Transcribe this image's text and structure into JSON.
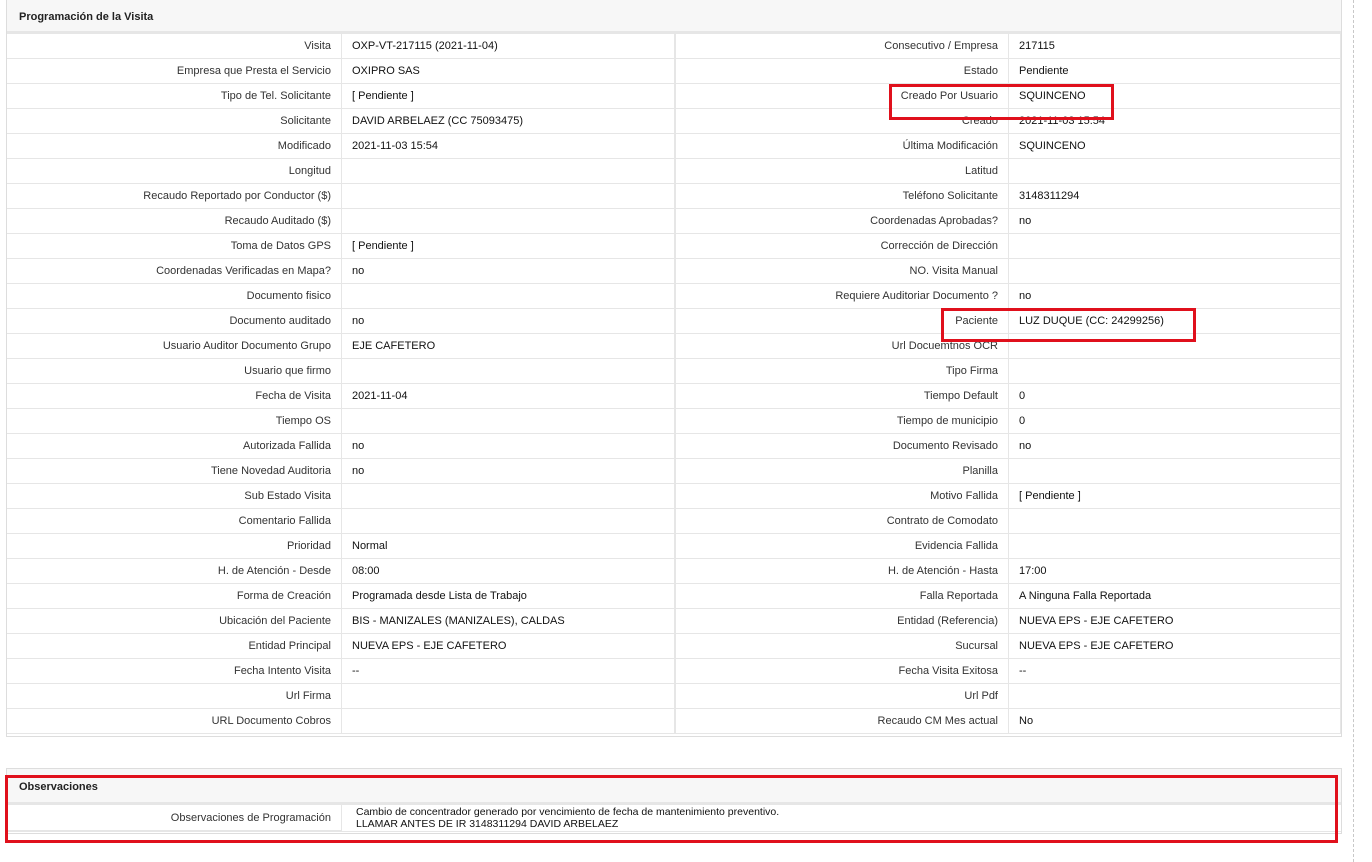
{
  "visit_section": {
    "title": "Programación de la Visita",
    "rows": [
      {
        "l1": "Visita",
        "v1": "OXP-VT-217115 (2021-11-04)",
        "l2": "Consecutivo / Empresa",
        "v2": "217115"
      },
      {
        "l1": "Empresa que Presta el Servicio",
        "v1": "OXIPRO SAS",
        "l2": "Estado",
        "v2": "Pendiente"
      },
      {
        "l1": "Tipo de Tel. Solicitante",
        "v1": "[ Pendiente ]",
        "l2": "Creado Por Usuario",
        "v2": "SQUINCENO"
      },
      {
        "l1": "Solicitante",
        "v1": "DAVID ARBELAEZ (CC 75093475)",
        "l2": "Creado",
        "v2": "2021-11-03 15:54"
      },
      {
        "l1": "Modificado",
        "v1": "2021-11-03 15:54",
        "l2": "Última Modificación",
        "v2": " SQUINCENO"
      },
      {
        "l1": "Longitud",
        "v1": "",
        "l2": "Latitud",
        "v2": ""
      },
      {
        "l1": "Recaudo Reportado por Conductor ($)",
        "v1": "",
        "l2": "Teléfono Solicitante",
        "v2": "3148311294"
      },
      {
        "l1": "Recaudo Auditado ($)",
        "v1": "",
        "l2": "Coordenadas Aprobadas?",
        "v2": " no"
      },
      {
        "l1": "Toma de Datos GPS",
        "v1": "[ Pendiente ]",
        "l2": "Corrección de Dirección",
        "v2": ""
      },
      {
        "l1": "Coordenadas Verificadas en Mapa?",
        "v1": " no",
        "l2": "NO. Visita Manual",
        "v2": ""
      },
      {
        "l1": "Documento fisico",
        "v1": "",
        "l2": "Requiere Auditoriar Documento ?",
        "v2": " no"
      },
      {
        "l1": "Documento auditado",
        "v1": " no",
        "l2": "Paciente",
        "v2": "LUZ DUQUE (CC: 24299256)"
      },
      {
        "l1": "Usuario Auditor Documento Grupo",
        "v1": "EJE CAFETERO",
        "l2": "Url Docuemtnos OCR",
        "v2": ""
      },
      {
        "l1": "Usuario que firmo",
        "v1": "",
        "l2": "Tipo Firma",
        "v2": ""
      },
      {
        "l1": "Fecha de Visita",
        "v1": " 2021-11-04",
        "l2": "Tiempo Default",
        "v2": "0"
      },
      {
        "l1": "Tiempo OS",
        "v1": "",
        "l2": "Tiempo de municipio",
        "v2": "0"
      },
      {
        "l1": "Autorizada Fallida",
        "v1": " no",
        "l2": "Documento Revisado",
        "v2": " no"
      },
      {
        "l1": "Tiene Novedad Auditoria",
        "v1": " no",
        "l2": "Planilla",
        "v2": ""
      },
      {
        "l1": "Sub Estado Visita",
        "v1": "",
        "l2": "Motivo Fallida",
        "v2": "[ Pendiente ]"
      },
      {
        "l1": "Comentario Fallida",
        "v1": "",
        "l2": "Contrato de Comodato",
        "v2": ""
      },
      {
        "l1": "Prioridad",
        "v1": "Normal",
        "l2": "Evidencia Fallida",
        "v2": ""
      },
      {
        "l1": "H. de Atención - Desde",
        "v1": "08:00",
        "l2": "H. de Atención - Hasta",
        "v2": "17:00"
      },
      {
        "l1": "Forma de Creación",
        "v1": "Programada desde Lista de Trabajo",
        "l2": "Falla Reportada",
        "v2": "A Ninguna Falla Reportada"
      },
      {
        "l1": "Ubicación del Paciente",
        "v1": "BIS - MANIZALES (MANIZALES), CALDAS",
        "l2": "Entidad (Referencia)",
        "v2": "NUEVA EPS - EJE CAFETERO"
      },
      {
        "l1": "Entidad Principal",
        "v1": "NUEVA EPS - EJE CAFETERO",
        "l2": "Sucursal",
        "v2": "NUEVA EPS - EJE CAFETERO"
      },
      {
        "l1": "Fecha Intento Visita",
        "v1": " --",
        "l2": "Fecha Visita Exitosa",
        "v2": " --"
      },
      {
        "l1": "Url Firma",
        "v1": "",
        "l2": "Url Pdf",
        "v2": ""
      },
      {
        "l1": "URL Documento Cobros",
        "v1": "",
        "l2": "Recaudo CM Mes actual",
        "v2": "No"
      }
    ]
  },
  "observations_section": {
    "title": "Observaciones",
    "label": "Observaciones de Programación",
    "line1": "Cambio de concentrador generado por vencimiento de fecha de mantenimiento preventivo.",
    "line2": "LLAMAR ANTES DE IR 3148311294 DAVID ARBELAEZ"
  },
  "highlight_color": "#e0101c"
}
